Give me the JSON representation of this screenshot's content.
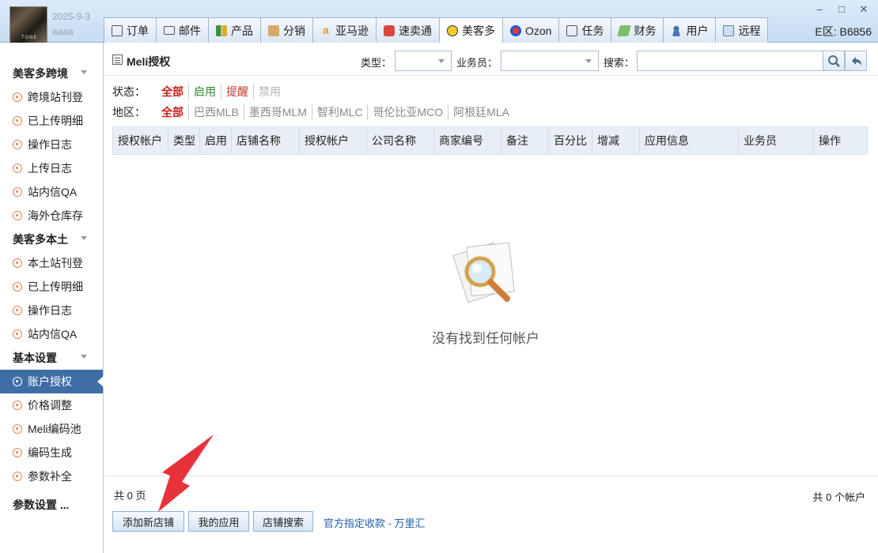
{
  "user": {
    "date": "2025-9-3",
    "name": "aaaa"
  },
  "tabs": [
    {
      "label": "订单",
      "icon": "clipboard-icon",
      "color": "#6b6b6b"
    },
    {
      "label": "邮件",
      "icon": "mail-icon",
      "color": "#6b6b6b"
    },
    {
      "label": "产品",
      "icon": "product-grid-icon",
      "color": "#3c8f3c"
    },
    {
      "label": "分销",
      "icon": "package-icon",
      "color": "#c9954a"
    },
    {
      "label": "亚马逊",
      "icon": "amazon-icon",
      "color": "#e59a20"
    },
    {
      "label": "速卖通",
      "icon": "aliexpress-icon",
      "color": "#d9483b"
    },
    {
      "label": "美客多",
      "icon": "mercadolibre-icon",
      "color": "#f2cf2b"
    },
    {
      "label": "Ozon",
      "icon": "ozon-icon",
      "color": "#2155d6"
    },
    {
      "label": "任务",
      "icon": "task-icon",
      "color": "#6b6b6b"
    },
    {
      "label": "财务",
      "icon": "money-icon",
      "color": "#4c9a3c"
    },
    {
      "label": "用户",
      "icon": "user-icon",
      "color": "#4774b8"
    },
    {
      "label": "远程",
      "icon": "monitor-icon",
      "color": "#5c7fa8"
    }
  ],
  "region": "E区: B6856",
  "sidebar": {
    "sections": [
      {
        "title": "美客多跨境",
        "items": [
          "跨境站刊登",
          "已上传明细",
          "操作日志",
          "上传日志",
          "站内信QA",
          "海外仓库存"
        ]
      },
      {
        "title": "美客多本土",
        "items": [
          "本土站刊登",
          "已上传明细",
          "操作日志",
          "站内信QA"
        ]
      },
      {
        "title": "基本设置",
        "items": [
          "账户授权",
          "价格调整",
          "Meli编码池",
          "编码生成",
          "参数补全"
        ]
      },
      {
        "title": "参数设置 ..."
      }
    ]
  },
  "main": {
    "title": "Meli授权",
    "type_label": "类型：",
    "salesman_label": "业务员：",
    "search_label": "搜索：",
    "status": {
      "label": "状态：",
      "options": [
        "全部",
        "启用",
        "提醒",
        "禁用"
      ]
    },
    "area": {
      "label": "地区：",
      "options": [
        "全部",
        "巴西MLB",
        "墨西哥MLM",
        "智利MLC",
        "哥伦比亚MCO",
        "阿根廷MLA"
      ]
    },
    "columns": [
      "授权帐户",
      "类型",
      "启用",
      "店铺名称",
      "授权帐户",
      "公司名称",
      "商家编号",
      "备注",
      "百分比",
      "增减",
      "应用信息",
      "业务员",
      "操作"
    ],
    "empty_text": "没有找到任何帐户",
    "pages_text": "共 0 页",
    "count_text": "共 0 个帐户",
    "buttons": {
      "add_store": "添加新店铺",
      "my_apps": "我的应用",
      "store_search": "店铺搜索"
    },
    "payment_link": "官方指定收款 - 万里汇"
  },
  "colors": {
    "accent": "#3f6ea6",
    "selected_filter": "#d11a1a",
    "annotation_arrow": "#e8323a"
  }
}
